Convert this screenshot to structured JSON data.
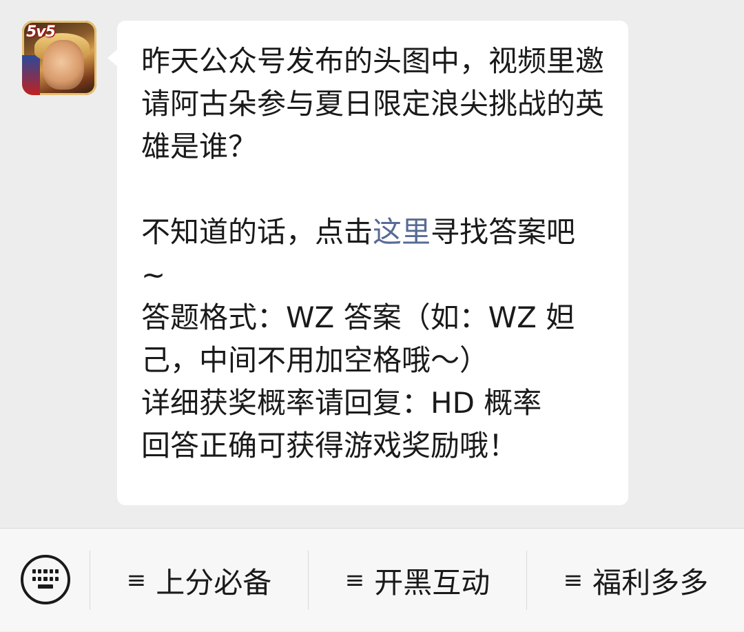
{
  "chat": {
    "avatar_badge": "5v5",
    "message": {
      "part1": "昨天公众号发布的头图中，视频里邀请阿古朵参与夏日限定浪尖挑战的英雄是谁？\n\n不知道的话，点击",
      "link_text": "这里",
      "part2": "寻找答案吧\n~\n答题格式：WZ 答案（如：WZ 妲己，中间不用加空格哦～）\n详细获奖概率请回复：HD 概率\n回答正确可获得游戏奖励哦！"
    },
    "link_color": "#576b95"
  },
  "bottom_menu": {
    "keyboard_icon": "keyboard-icon",
    "items": [
      {
        "icon": "≡",
        "label": "上分必备"
      },
      {
        "icon": "≡",
        "label": "开黑互动"
      },
      {
        "icon": "≡",
        "label": "福利多多"
      }
    ]
  }
}
